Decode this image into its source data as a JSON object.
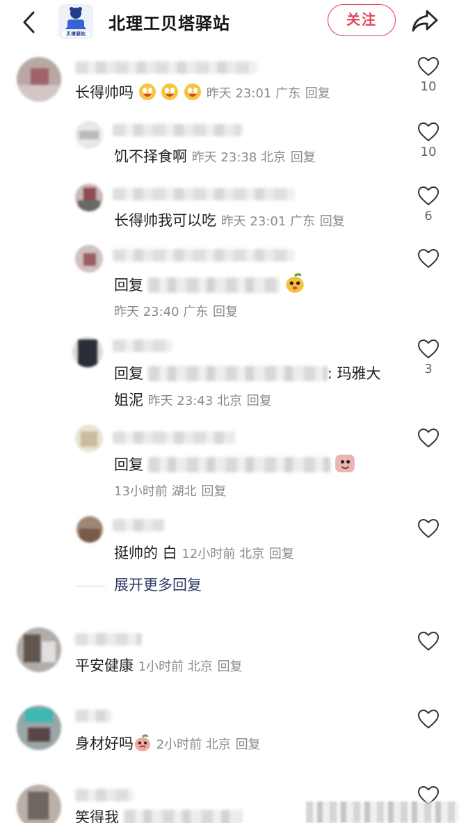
{
  "header": {
    "title": "北理工贝塔驿站",
    "logo_caption": "贝塔驿站",
    "follow_label": "关注"
  },
  "comments": [
    {
      "text": "长得帅吗",
      "meta": "昨天 23:01 广东",
      "reply": "回复",
      "likes": "10"
    },
    {
      "text": "饥不择食啊",
      "meta": "昨天 23:38 北京",
      "reply": "回复",
      "likes": "10"
    },
    {
      "text": "长得帅我可以吃",
      "meta": "昨天 23:01 广东",
      "reply": "回复",
      "likes": "6"
    },
    {
      "text": "回复",
      "meta": "昨天 23:40 广东",
      "reply": "回复",
      "likes": ""
    },
    {
      "text": "回复",
      "text_suffix": ": 玛雅大",
      "text_line2": "姐泥",
      "meta": "昨天 23:43 北京",
      "reply": "回复",
      "likes": "3"
    },
    {
      "text": "回复",
      "meta": "13小时前 湖北",
      "reply": "回复",
      "likes": ""
    },
    {
      "text": "挺帅的  白",
      "meta": "12小时前 北京",
      "reply": "回复",
      "likes": ""
    },
    {
      "text": "平安健康",
      "meta": "1小时前 北京",
      "reply": "回复",
      "likes": ""
    },
    {
      "text": "身材好吗",
      "meta": "2小时前 北京",
      "reply": "回复",
      "likes": ""
    },
    {
      "text": "笑得我",
      "meta": "",
      "reply": "",
      "likes": ""
    }
  ],
  "expand_label": "展开更多回复",
  "colors": {
    "accent": "#e0465a",
    "link": "#2b3a67",
    "meta": "#8a8a8a"
  }
}
